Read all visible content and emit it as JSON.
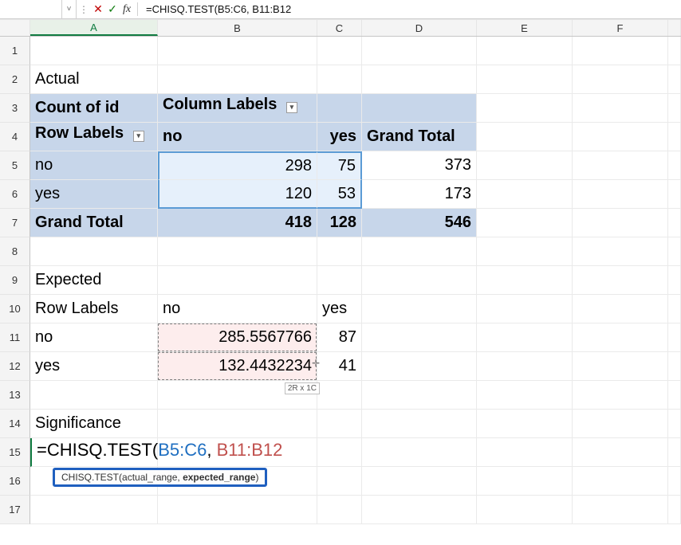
{
  "formula_bar": {
    "cancel_glyph": "✕",
    "enter_glyph": "✓",
    "fx_glyph": "fx",
    "text": "=CHISQ.TEST(B5:C6, B11:B12"
  },
  "cols": {
    "A": "A",
    "B": "B",
    "C": "C",
    "D": "D",
    "E": "E",
    "F": "F"
  },
  "rows": [
    "1",
    "2",
    "3",
    "4",
    "5",
    "6",
    "7",
    "8",
    "9",
    "10",
    "11",
    "12",
    "13",
    "14",
    "15",
    "16",
    "17"
  ],
  "cells": {
    "A2": "Actual",
    "A3": "Count of id",
    "B3": "Column Labels",
    "A4": "Row Labels",
    "B4": "no",
    "C4": "yes",
    "D4": "Grand Total",
    "A5": "no",
    "B5": "298",
    "C5": "75",
    "D5": "373",
    "A6": "yes",
    "B6": "120",
    "C6": "53",
    "D6": "173",
    "A7": "Grand Total",
    "B7": "418",
    "C7": "128",
    "D7": "546",
    "A9": "Expected",
    "A10": "Row Labels",
    "B10": "no",
    "C10": "yes",
    "A11": "no",
    "B11": "285.5567766",
    "C11": "87",
    "A12": "yes",
    "B12": "132.4432234",
    "C12": "41",
    "A14": "Significance",
    "A15_formula_prefix": "=CHISQ.TEST(",
    "A15_arg1": "B5:C6",
    "A15_comma": ", ",
    "A15_arg2": "B11:B12"
  },
  "tooltip": {
    "fn": "CHISQ.TEST(",
    "arg1": "actual_range",
    "sep": ", ",
    "arg2": "expected_range",
    "close": ")"
  },
  "hints": {
    "size": "2R x 1C",
    "dropdown_glyph": "▾",
    "fill_glyph": "✛"
  },
  "chart_data": {
    "type": "table",
    "tables": [
      {
        "title": "Actual — Count of id",
        "rows_label": "Row Labels",
        "cols_label": "Column Labels",
        "columns": [
          "no",
          "yes",
          "Grand Total"
        ],
        "rows": [
          {
            "label": "no",
            "values": [
              298,
              75,
              373
            ]
          },
          {
            "label": "yes",
            "values": [
              120,
              53,
              173
            ]
          },
          {
            "label": "Grand Total",
            "values": [
              418,
              128,
              546
            ]
          }
        ]
      },
      {
        "title": "Expected",
        "rows_label": "Row Labels",
        "columns": [
          "no",
          "yes"
        ],
        "rows": [
          {
            "label": "no",
            "values": [
              285.5567766,
              87
            ]
          },
          {
            "label": "yes",
            "values": [
              132.4432234,
              41
            ]
          }
        ]
      }
    ],
    "formula_cell": "=CHISQ.TEST(B5:C6, B11:B12",
    "selected_ranges": {
      "actual_range": "B5:C6",
      "expected_range": "B11:B12"
    }
  }
}
